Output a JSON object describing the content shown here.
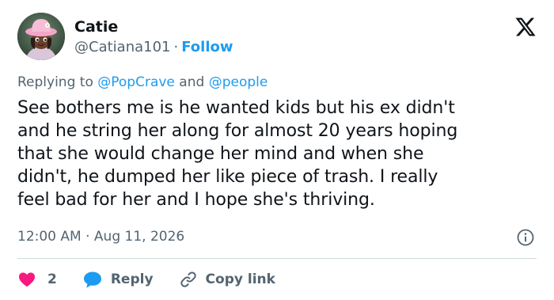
{
  "colors": {
    "accent": "#1d9bf0",
    "like": "#f91880",
    "text": "#0f1419",
    "muted": "#536471",
    "divider": "#cfd9de"
  },
  "author": {
    "display_name": "Catie",
    "handle": "@Catiana101",
    "separator": "·",
    "follow_label": "Follow",
    "avatar_icon": "cartoon-girl-pink-hat-avatar"
  },
  "brand_icon": "x-logo-icon",
  "reply_context": {
    "prefix": "Replying to",
    "mention_1": "@PopCrave",
    "joiner": "and",
    "mention_2": "@people"
  },
  "tweet": {
    "lines": [
      "See bothers me is he wanted kids but his ex didn't",
      "and he string her along for almost 20 years hoping",
      "that she would change her mind and when she",
      "didn't, he dumped her like piece of trash. I really",
      "feel bad for her and I hope she's thriving."
    ],
    "time": "12:00 AM",
    "separator": "·",
    "date": "Aug 11, 2026",
    "info_icon": "info-icon"
  },
  "actions": {
    "like_count": "2",
    "like_icon": "heart-icon",
    "reply_label": "Reply",
    "reply_icon": "speech-bubble-icon",
    "copy_label": "Copy link",
    "copy_icon": "link-icon"
  }
}
